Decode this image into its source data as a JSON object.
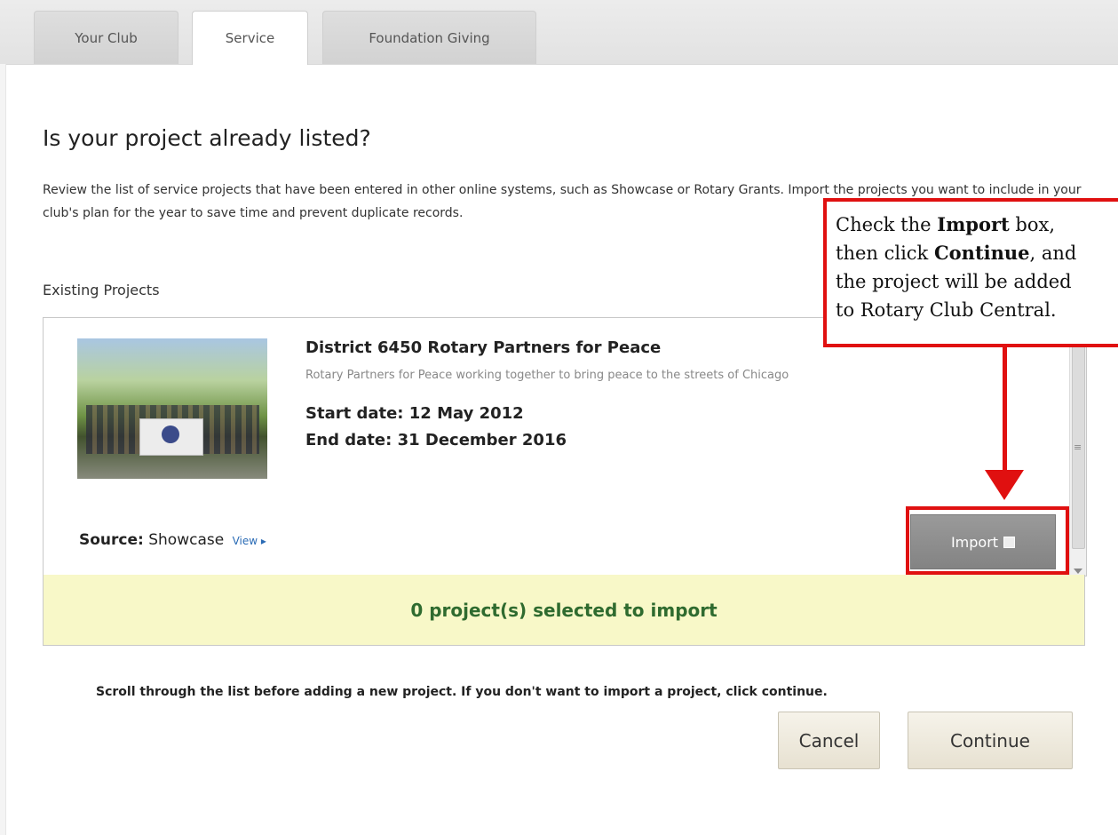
{
  "tabs": [
    {
      "label": "Your Club",
      "active": false
    },
    {
      "label": "Service",
      "active": true
    },
    {
      "label": "Foundation Giving",
      "active": false
    }
  ],
  "page": {
    "title": "Is your project already listed?",
    "intro": "Review the list of service projects that have been entered in other online systems, such as Showcase or Rotary Grants. Import the projects you want to include in your club's plan for the year to save time and prevent duplicate records.",
    "section_label": "Existing Projects"
  },
  "project": {
    "title": "District 6450 Rotary Partners for Peace",
    "description": "Rotary Partners for Peace working together to bring peace to the streets of Chicago",
    "start_date": "Start date: 12 May 2012",
    "end_date": "End date: 31 December 2016",
    "source_label": "Source:",
    "source_value": "Showcase",
    "view_link": "View ▸",
    "import_label": "Import"
  },
  "selection_status": "0 project(s) selected to import",
  "scroll_note": "Scroll through the list before adding a new project. If you don't want to import a project, click continue.",
  "buttons": {
    "cancel": "Cancel",
    "continue": "Continue"
  },
  "callout": {
    "part1": "Check the ",
    "bold1": "Import",
    "part2": " box,",
    "part3": "then click ",
    "bold2": "Continue",
    "part4": ", and",
    "line3": "the project will be added",
    "line4": "to Rotary Club Central."
  },
  "colors": {
    "callout_border": "#e01010",
    "status_bar_bg": "#f8f8c8",
    "status_text": "#2f6b2f",
    "link": "#2a6bb5",
    "import_button": "#8e8e8e"
  }
}
